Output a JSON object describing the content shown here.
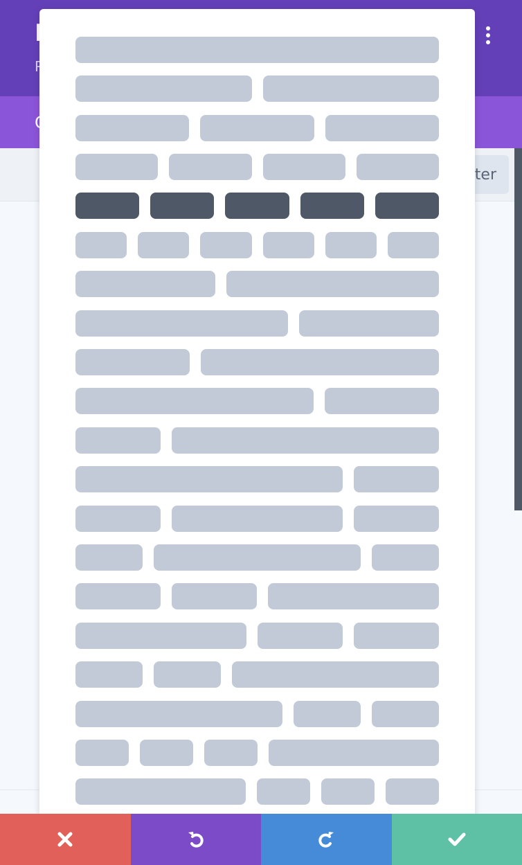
{
  "header": {
    "title": "P",
    "subtitle": "P",
    "more_icon": "kebab-icon"
  },
  "tabs": {
    "active_label": "C"
  },
  "toolbar": {
    "filter_label": "ter"
  },
  "actions": {
    "cancel_icon": "close-icon",
    "undo_icon": "undo-icon",
    "redo_icon": "redo-icon",
    "save_icon": "check-icon"
  },
  "colors": {
    "header": "#6440b8",
    "tabs": "#8a55d8",
    "cancel": "#e2605a",
    "undo": "#7c4cc8",
    "redo": "#458bd8",
    "save": "#5ec1a6",
    "skeleton": "#c2cad7",
    "skeleton_dark": "#4e5866"
  }
}
